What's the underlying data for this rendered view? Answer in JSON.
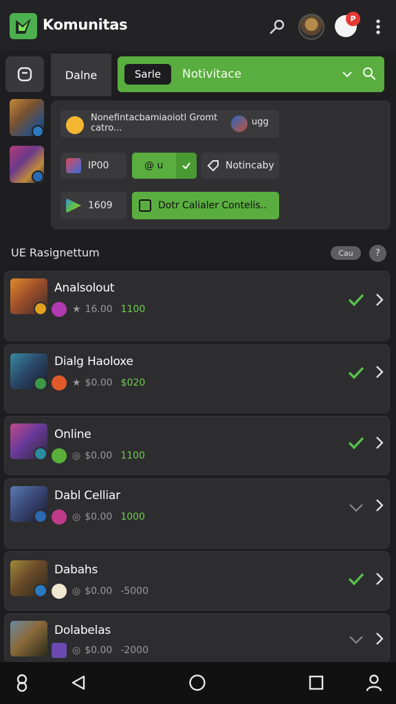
{
  "header": {
    "title": "Komunitas",
    "icons": [
      "logo-icon",
      "search-icon",
      "profile-avatar",
      "notification-icon",
      "more-vertical-icon"
    ],
    "notification_badge": "P"
  },
  "rail": {
    "button_icon": "square-icon"
  },
  "filter": {
    "tab_label": "Dalne",
    "search_label": "Sarle",
    "filter_label": "Notivitace"
  },
  "panel": {
    "message": "Nonefintacbamiaoiotl Gromt catro...",
    "message_tag": "ugg",
    "item_ip": "IP00",
    "item_code": "@ u",
    "item_notif": "Notincaby",
    "item_count": "1609",
    "item_action": "Dotr Calialer Contelis.."
  },
  "section": {
    "title": "UE Rasignettum",
    "pill": "Cau",
    "help": "?"
  },
  "list": [
    {
      "name": "Analsolout",
      "stat": "16.00",
      "price": "1100",
      "status": "online"
    },
    {
      "name": "Dialg Haoloxe",
      "stat": "$0.00",
      "price": "$020",
      "status": "online"
    },
    {
      "name": "Online",
      "stat": "$0.00",
      "price": "1100",
      "status": "online"
    },
    {
      "name": "Dabl Celliar",
      "stat": "$0.00",
      "price": "1000",
      "status": "away"
    },
    {
      "name": "Dabahs",
      "stat": "$0.00",
      "price": "-5000",
      "status": "online"
    },
    {
      "name": "Dolabelas",
      "stat": "$0.00",
      "price": "-2000",
      "status": "away"
    }
  ],
  "bottom_nav": [
    "ring-icon",
    "back-icon",
    "home-icon",
    "recents-icon",
    "user-icon"
  ],
  "colors": {
    "accent": "#5aad3f",
    "background": "#1e1e20",
    "card": "#2d2d30",
    "check": "#58c14a"
  }
}
